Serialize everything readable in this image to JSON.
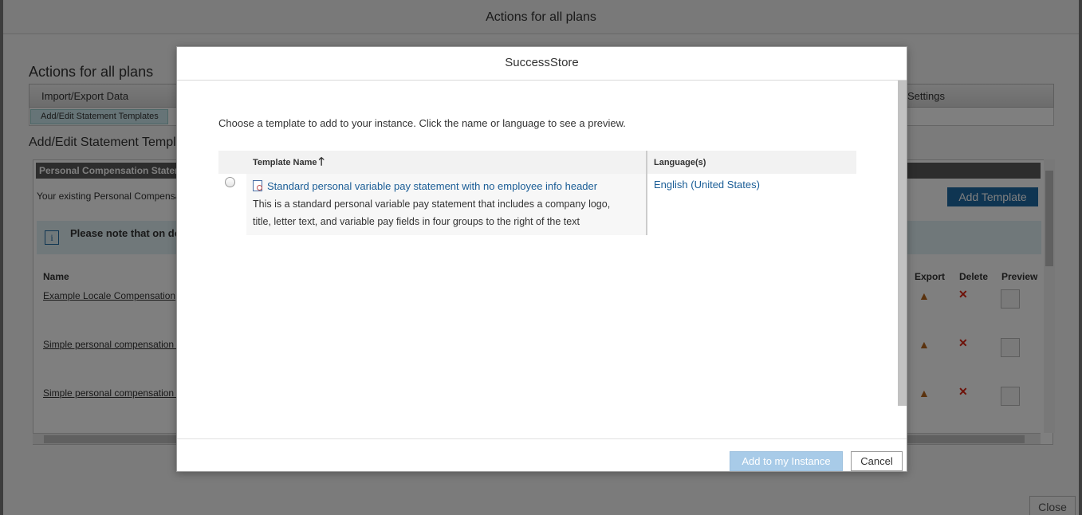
{
  "background": {
    "window_title": "Actions for all plans",
    "page_heading": "Actions for all plans",
    "tabs": [
      {
        "label": "Import/Export Data"
      },
      {
        "label": "Settings"
      }
    ],
    "active_subtab": "Add/Edit Statement Templates",
    "section_title": "Add/Edit Statement Templ",
    "panel_header": "Personal Compensation Stater",
    "panel_text": "Your existing Personal Compensa",
    "add_template_label": "Add Template",
    "info_text": "Please note that on do",
    "columns": {
      "name": "Name",
      "export": "Export",
      "delete": "Delete",
      "preview": "Preview"
    },
    "rows": [
      {
        "name": "Example Locale Compensation"
      },
      {
        "name": "Simple personal compensation s"
      },
      {
        "name": "Simple personal compensation s"
      }
    ],
    "close_label": "Close"
  },
  "modal": {
    "title": "SuccessStore",
    "intro": "Choose a template to add to your instance. Click the name or language to see a preview.",
    "table": {
      "col_template_name": "Template Name",
      "sort_indicator": "🡑",
      "col_languages": "Language(s)",
      "rows": [
        {
          "name": "Standard personal variable pay statement with no employee info header",
          "description_line1": "This is a standard personal variable pay statement that includes a company logo,",
          "description_line2": "title, letter text, and variable pay fields in four groups to the right of the text",
          "language": "English (United States)"
        }
      ]
    },
    "add_button_label": "Add to my Instance",
    "cancel_button_label": "Cancel"
  }
}
